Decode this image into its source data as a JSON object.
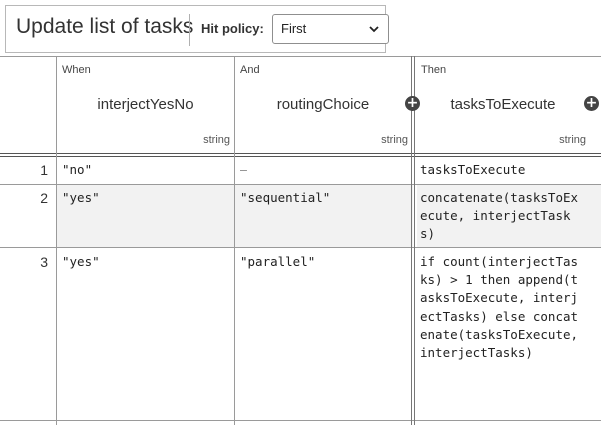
{
  "header": {
    "title": "Update list of tasks",
    "hit_policy_label": "Hit policy:",
    "hit_policy_value": "First"
  },
  "columns": [
    {
      "group": "When",
      "name": "interjectYesNo",
      "type": "string"
    },
    {
      "group": "And",
      "name": "routingChoice",
      "type": "string"
    },
    {
      "group": "Then",
      "name": "tasksToExecute",
      "type": "string"
    }
  ],
  "rows": [
    {
      "num": "1",
      "cells": [
        "\"no\"",
        "–",
        "tasksToExecute"
      ]
    },
    {
      "num": "2",
      "cells": [
        "\"yes\"",
        "\"sequential\"",
        "concatenate(tasksToExecute, interjectTasks)"
      ]
    },
    {
      "num": "3",
      "cells": [
        "\"yes\"",
        "\"parallel\"",
        "if count(interjectTasks) > 1 then append(tasksToExecute, interjectTasks) else concatenate(tasksToExecute, interjectTasks)"
      ]
    }
  ],
  "icons": {
    "add": "plus-circle-icon",
    "dropdown": "chevron-down-icon"
  }
}
